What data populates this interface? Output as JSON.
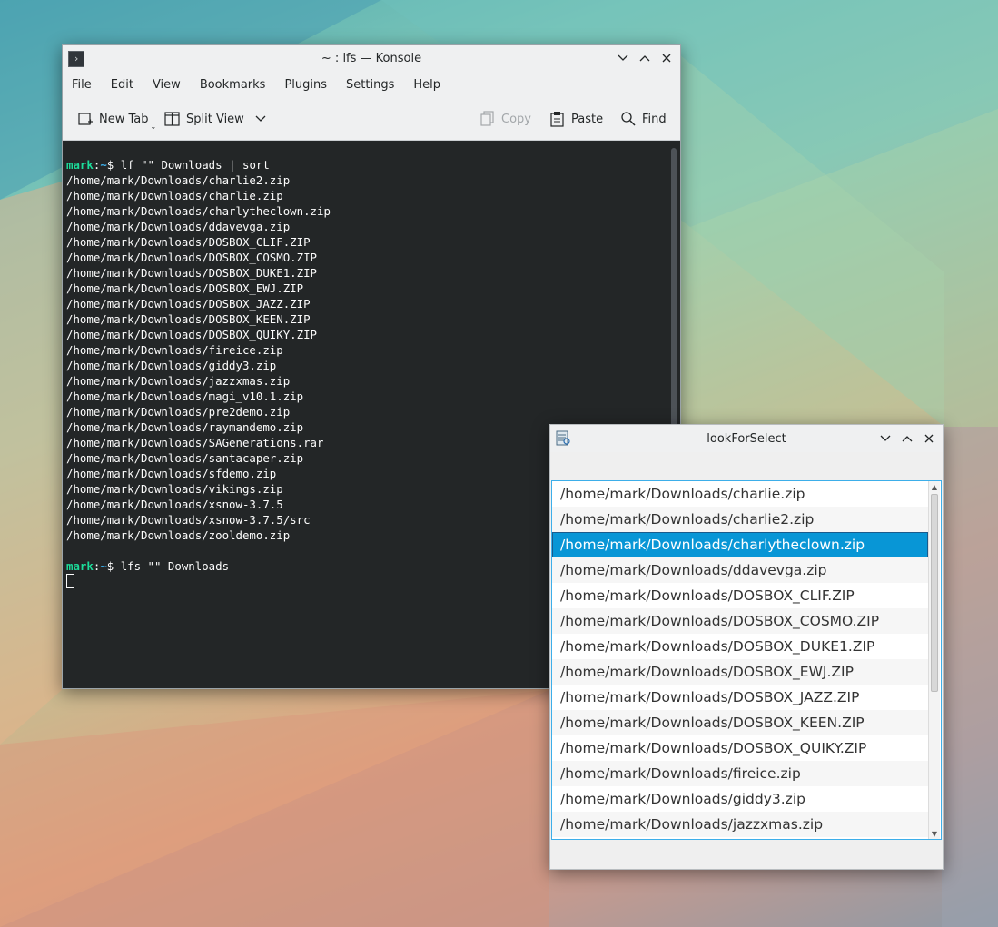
{
  "colors": {
    "terminal_bg": "#232627",
    "prompt_user": "#1cdc9a",
    "prompt_path": "#3daee9",
    "selection": "#0896d6"
  },
  "konsole": {
    "title": "~ : lfs — Konsole",
    "menu": [
      "File",
      "Edit",
      "View",
      "Bookmarks",
      "Plugins",
      "Settings",
      "Help"
    ],
    "toolbar": {
      "new_tab": "New Tab",
      "split_view": "Split View",
      "copy": "Copy",
      "paste": "Paste",
      "find": "Find"
    },
    "prompt1": {
      "user": "mark",
      "path": "~",
      "command": "lf \"\" Downloads | sort"
    },
    "output": [
      "/home/mark/Downloads/charlie2.zip",
      "/home/mark/Downloads/charlie.zip",
      "/home/mark/Downloads/charlytheclown.zip",
      "/home/mark/Downloads/ddavevga.zip",
      "/home/mark/Downloads/DOSBOX_CLIF.ZIP",
      "/home/mark/Downloads/DOSBOX_COSMO.ZIP",
      "/home/mark/Downloads/DOSBOX_DUKE1.ZIP",
      "/home/mark/Downloads/DOSBOX_EWJ.ZIP",
      "/home/mark/Downloads/DOSBOX_JAZZ.ZIP",
      "/home/mark/Downloads/DOSBOX_KEEN.ZIP",
      "/home/mark/Downloads/DOSBOX_QUIKY.ZIP",
      "/home/mark/Downloads/fireice.zip",
      "/home/mark/Downloads/giddy3.zip",
      "/home/mark/Downloads/jazzxmas.zip",
      "/home/mark/Downloads/magi_v10.1.zip",
      "/home/mark/Downloads/pre2demo.zip",
      "/home/mark/Downloads/raymandemo.zip",
      "/home/mark/Downloads/SAGenerations.rar",
      "/home/mark/Downloads/santacaper.zip",
      "/home/mark/Downloads/sfdemo.zip",
      "/home/mark/Downloads/vikings.zip",
      "/home/mark/Downloads/xsnow-3.7.5",
      "/home/mark/Downloads/xsnow-3.7.5/src",
      "/home/mark/Downloads/zooldemo.zip"
    ],
    "prompt2": {
      "user": "mark",
      "path": "~",
      "command": "lfs \"\" Downloads"
    }
  },
  "lookforselect": {
    "title": "lookForSelect",
    "selected_index": 2,
    "items": [
      "/home/mark/Downloads/charlie.zip",
      "/home/mark/Downloads/charlie2.zip",
      "/home/mark/Downloads/charlytheclown.zip",
      "/home/mark/Downloads/ddavevga.zip",
      "/home/mark/Downloads/DOSBOX_CLIF.ZIP",
      "/home/mark/Downloads/DOSBOX_COSMO.ZIP",
      "/home/mark/Downloads/DOSBOX_DUKE1.ZIP",
      "/home/mark/Downloads/DOSBOX_EWJ.ZIP",
      "/home/mark/Downloads/DOSBOX_JAZZ.ZIP",
      "/home/mark/Downloads/DOSBOX_KEEN.ZIP",
      "/home/mark/Downloads/DOSBOX_QUIKY.ZIP",
      "/home/mark/Downloads/fireice.zip",
      "/home/mark/Downloads/giddy3.zip",
      "/home/mark/Downloads/jazzxmas.zip"
    ]
  }
}
